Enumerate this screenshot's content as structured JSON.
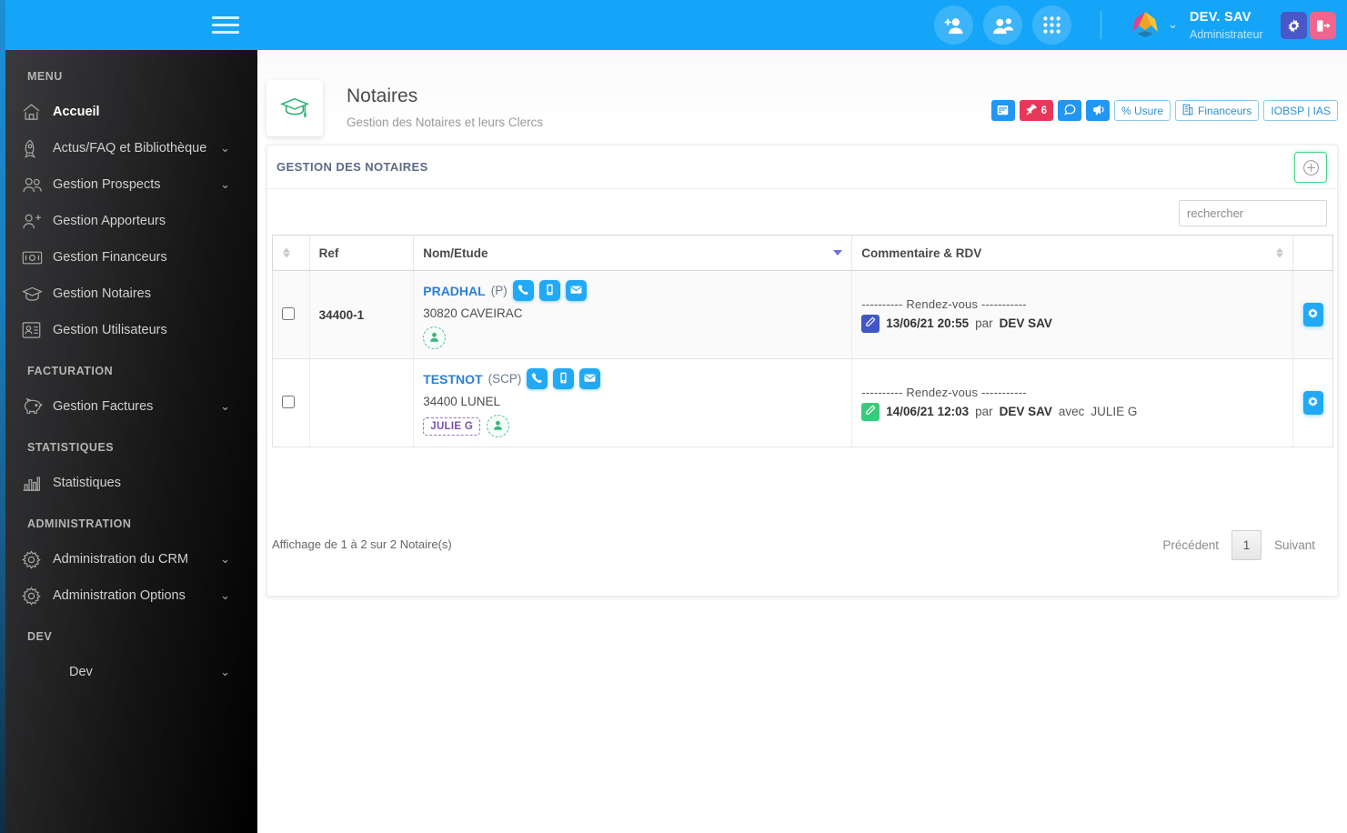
{
  "topbar": {
    "menu_toggle": "menu-toggle",
    "icons": [
      {
        "name": "add-user-icon",
        "label": "Ajouter un utilisateur"
      },
      {
        "name": "users-icon",
        "label": "Utilisateurs"
      },
      {
        "name": "apps-grid-icon",
        "label": "Applications"
      }
    ],
    "user_name": "DEV. SAV",
    "user_role": "Administrateur",
    "settings_label": "Paramètres",
    "logout_label": "Déconnexion",
    "caret": "⌄",
    "accent_color": "#15a5f8",
    "settings_color": "#4a57c8",
    "logout_color": "#f2638f"
  },
  "sidebar": {
    "sections": [
      {
        "title": "MENU",
        "items": [
          {
            "label": "Accueil",
            "icon": "home-icon",
            "active": true,
            "caret": ""
          },
          {
            "label": "Actus/FAQ et Bibliothèque",
            "icon": "rocket-icon",
            "active": false,
            "caret": "⌄"
          },
          {
            "label": "Gestion Prospects",
            "icon": "people-icon",
            "active": false,
            "caret": "⌄"
          },
          {
            "label": "Gestion Apporteurs",
            "icon": "person-add-icon",
            "active": false,
            "caret": ""
          },
          {
            "label": "Gestion Financeurs",
            "icon": "money-icon",
            "active": false,
            "caret": ""
          },
          {
            "label": "Gestion Notaires",
            "icon": "graduation-cap-icon",
            "active": false,
            "caret": ""
          },
          {
            "label": "Gestion Utilisateurs",
            "icon": "id-card-icon",
            "active": false,
            "caret": ""
          }
        ]
      },
      {
        "title": "FACTURATION",
        "items": [
          {
            "label": "Gestion Factures",
            "icon": "piggy-bank-icon",
            "active": false,
            "caret": "⌄"
          }
        ]
      },
      {
        "title": "STATISTIQUES",
        "items": [
          {
            "label": "Statistiques",
            "icon": "bar-chart-icon",
            "active": false,
            "caret": ""
          }
        ]
      },
      {
        "title": "ADMINISTRATION",
        "items": [
          {
            "label": "Administration du CRM",
            "icon": "gear-icon",
            "active": false,
            "caret": "⌄"
          },
          {
            "label": "Administration Options",
            "icon": "gear-icon",
            "active": false,
            "caret": "⌄"
          }
        ]
      },
      {
        "title": "DEV",
        "items": [
          {
            "label": "Dev",
            "icon": "",
            "active": false,
            "caret": "⌄",
            "indent": true
          }
        ]
      }
    ]
  },
  "page": {
    "icon": "graduation-cap-icon",
    "title": "Notaires",
    "subtitle": "Gestion des Notaires et leurs Clercs",
    "badges": [
      {
        "name": "calendar-badge",
        "type": "icon",
        "icon": "calendar-icon",
        "label": "",
        "color": "#2196f3"
      },
      {
        "name": "pin-badge",
        "type": "pin",
        "icon": "pin-icon",
        "label": "6",
        "color": "#e8385a"
      },
      {
        "name": "chat-badge",
        "type": "icon",
        "icon": "chat-bubble-icon",
        "label": "",
        "color": "#2196f3"
      },
      {
        "name": "megaphone-badge",
        "type": "icon",
        "icon": "megaphone-icon",
        "label": "",
        "color": "#2196f3"
      },
      {
        "name": "usure-badge",
        "type": "outline",
        "icon": "",
        "label": "% Usure",
        "color": "#2d8fd5"
      },
      {
        "name": "financeurs-badge",
        "type": "outline",
        "icon": "building-icon",
        "label": "Financeurs",
        "color": "#2d8fd5"
      },
      {
        "name": "iobsp-ias-badge",
        "type": "outline",
        "icon": "",
        "label": "IOBSP | IAS",
        "color": "#2d8fd5"
      }
    ]
  },
  "card": {
    "title": "GESTION DES NOTAIRES",
    "add_button_label": "Ajouter",
    "add_button_icon": "plus-circle-icon"
  },
  "search": {
    "placeholder": "rechercher",
    "value": ""
  },
  "table": {
    "columns": [
      {
        "label": "",
        "sort": "both",
        "key": "checkbox"
      },
      {
        "label": "Ref",
        "sort": "none",
        "key": "ref"
      },
      {
        "label": "Nom/Etude",
        "sort": "desc",
        "key": "nom"
      },
      {
        "label": "Commentaire & RDV",
        "sort": "both",
        "key": "commentaire"
      },
      {
        "label": "",
        "sort": "none",
        "key": "actions"
      }
    ],
    "rows": [
      {
        "checked": false,
        "ref": "34400-1",
        "name": "PRADHAL",
        "name_type": "(P)",
        "contact_icons": [
          "phone-icon",
          "mobile-icon",
          "email-icon"
        ],
        "address": "30820 CAVEIRAC",
        "clerk_tag": "",
        "add_person_icon": "add-person-icon",
        "rdv_separator": "---------- Rendez-vous -----------",
        "rdv_date": "13/06/21 20:55",
        "rdv_by_label": "par",
        "rdv_author": "DEV SAV",
        "rdv_with_label": "",
        "rdv_with": "",
        "pencil_color": "#4257c4",
        "action_icon": "gear-icon"
      },
      {
        "checked": false,
        "ref": "",
        "name": "TESTNOT",
        "name_type": "(SCP)",
        "contact_icons": [
          "phone-icon",
          "mobile-icon",
          "email-icon"
        ],
        "address": "34400 LUNEL",
        "clerk_tag": "JULIE G",
        "add_person_icon": "add-person-icon",
        "rdv_separator": "---------- Rendez-vous -----------",
        "rdv_date": "14/06/21 12:03",
        "rdv_by_label": "par",
        "rdv_author": "DEV SAV",
        "rdv_with_label": "avec",
        "rdv_with": "JULIE G",
        "pencil_color": "#3cc97b",
        "action_icon": "gear-icon"
      }
    ]
  },
  "footer": {
    "info": "Affichage de 1 à 2 sur 2 Notaire(s)",
    "prev_label": "Précédent",
    "page_number": "1",
    "next_label": "Suivant"
  }
}
